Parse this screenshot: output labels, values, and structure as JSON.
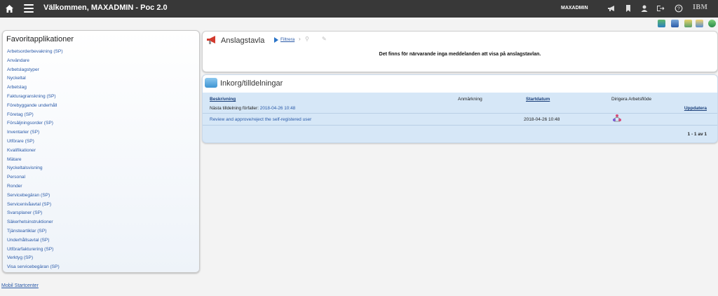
{
  "header": {
    "title": "Välkommen, MAXADMIN - Poc 2.0",
    "user": "MAXADMIN",
    "brand": "IBM",
    "icons": [
      "home-icon",
      "menu-icon",
      "megaphone-icon",
      "bookmarks-icon",
      "profile-icon",
      "signout-icon",
      "help-icon"
    ]
  },
  "favorites": {
    "title": "Favoritapplikationer",
    "items": [
      "Arbetsorderbevakning (SP)",
      "Användare",
      "Arbetslagstyper",
      "Nyckeltal",
      "Arbetslag",
      "Fakturagranskning (SP)",
      "Förebyggande underhåll",
      "Företag (SP)",
      "Försäljningsorder (SP)",
      "Inventarier (SP)",
      "Utförare (SP)",
      "Kvalifikationer",
      "Mätare",
      "Nyckeltalsvisning",
      "Personal",
      "Ronder",
      "Servicebegäran (SP)",
      "Servicenivåavtal (SP)",
      "Svarsplaner (SP)",
      "Säkerhetsinstruktioner",
      "Tjänsteartiklar (SP)",
      "Underhållsavtal (SP)",
      "Utförarfakturering (SP)",
      "Verktyg (SP)",
      "Visa servicebegäran (SP)"
    ]
  },
  "mobile_link": "Mobil Startcenter",
  "bulletin": {
    "title": "Anslagstavla",
    "filter_label": "Filtrera",
    "message": "Det finns för närvarande inga meddelanden att visa på anslagstavlan."
  },
  "inbox": {
    "title": "Inkorg/tilldelningar",
    "columns": {
      "description": "Beskrivning",
      "note": "Anmärkning",
      "start_date": "Startdatum",
      "route": "Dirigera Arbetsflöde"
    },
    "next_due_label": "Nästa tilldelning förfaller:",
    "next_due_value": "2018-04-26 10:48",
    "refresh_label": "Uppdatera",
    "rows": [
      {
        "description": "Review and approve/reject the self-registered user",
        "start_date": "2018-04-26 10:48"
      }
    ],
    "pager": "1 - 1 av 1"
  }
}
